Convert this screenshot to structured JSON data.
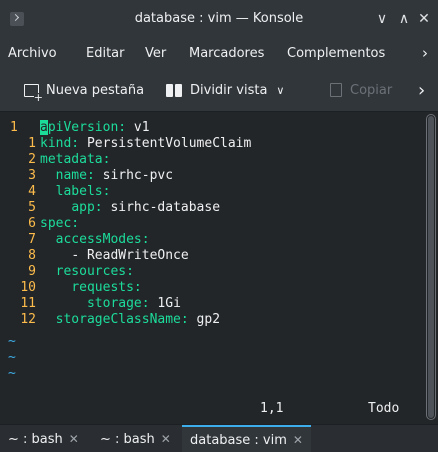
{
  "window": {
    "title": "database : vim — Konsole",
    "minimize_glyph": "∨",
    "maximize_glyph": "∧",
    "close_glyph": "✕"
  },
  "menubar": {
    "items": [
      "Archivo",
      "Editar",
      "Ver",
      "Marcadores",
      "Complementos"
    ],
    "more_glyph": "›"
  },
  "toolbar": {
    "new_tab_label": "Nueva pestaña",
    "split_view_label": "Dividir vista",
    "split_view_chevron": "∨",
    "copy_label": "Copiar",
    "more_glyph": "›"
  },
  "editor": {
    "lines": [
      {
        "num": "1",
        "current": true,
        "indent": "",
        "key": "apiVersion",
        "sep": ":",
        "value": " v1"
      },
      {
        "num": "1",
        "indent": "",
        "key": "kind",
        "sep": ":",
        "value": " PersistentVolumeClaim"
      },
      {
        "num": "2",
        "indent": "",
        "key": "metadata",
        "sep": ":",
        "value": ""
      },
      {
        "num": "3",
        "indent": "  ",
        "key": "name",
        "sep": ":",
        "value": " sirhc-pvc"
      },
      {
        "num": "4",
        "indent": "  ",
        "key": "labels",
        "sep": ":",
        "value": ""
      },
      {
        "num": "5",
        "indent": "    ",
        "key": "app",
        "sep": ":",
        "value": " sirhc-database"
      },
      {
        "num": "6",
        "indent": "",
        "key": "spec",
        "sep": ":",
        "value": ""
      },
      {
        "num": "7",
        "indent": "  ",
        "key": "accessModes",
        "sep": ":",
        "value": ""
      },
      {
        "num": "8",
        "indent": "    ",
        "key": "",
        "sep": "",
        "value": "- ReadWriteOnce"
      },
      {
        "num": "9",
        "indent": "  ",
        "key": "resources",
        "sep": ":",
        "value": ""
      },
      {
        "num": "10",
        "indent": "    ",
        "key": "requests",
        "sep": ":",
        "value": ""
      },
      {
        "num": "11",
        "indent": "      ",
        "key": "storage",
        "sep": ":",
        "value": " 1Gi"
      },
      {
        "num": "12",
        "indent": "  ",
        "key": "storageClassName",
        "sep": ":",
        "value": " gp2"
      }
    ],
    "empty_line_marker": "~",
    "empty_line_count": 3,
    "cursor_position": "1,1",
    "scroll_position": "Todo"
  },
  "tabs": [
    {
      "label": "~ : bash",
      "active": false
    },
    {
      "label": "~ : bash",
      "active": false
    },
    {
      "label": "database : vim",
      "active": true
    }
  ],
  "tab_close_glyph": "✕",
  "colors": {
    "background": "#232629",
    "chrome": "#31363b",
    "line_number": "#fdbc4b",
    "yaml_key": "#1cdc9a",
    "tilde": "#3daee9",
    "accent": "#3daee9"
  }
}
